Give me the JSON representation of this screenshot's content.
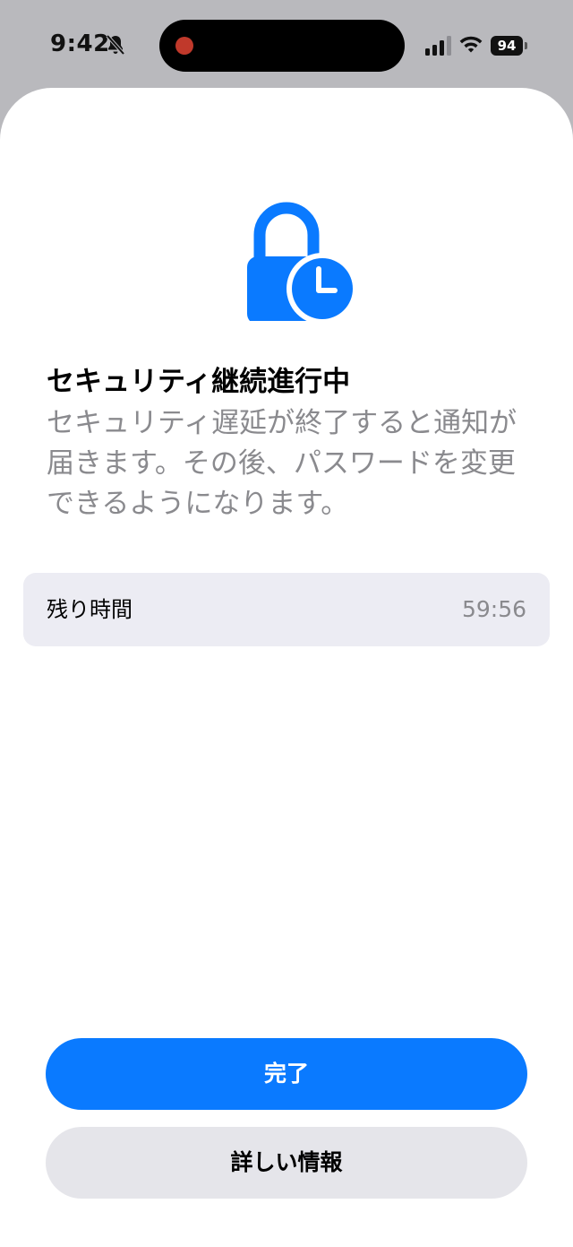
{
  "status_bar": {
    "time": "9:42",
    "battery_level": "94",
    "icons": [
      "bell-off-icon",
      "signal-icon",
      "wifi-icon",
      "battery-icon"
    ]
  },
  "sheet": {
    "icon": "lock-clock-icon",
    "accent_color": "#0a7aff",
    "title": "セキュリティ継続進行中",
    "description": "セキュリティ遅延が終了すると通知が届きます。その後、パスワードを変更できるようになります。",
    "timer": {
      "label": "残り時間",
      "value": "59:56"
    },
    "buttons": {
      "done_label": "完了",
      "more_info_label": "詳しい情報"
    }
  }
}
